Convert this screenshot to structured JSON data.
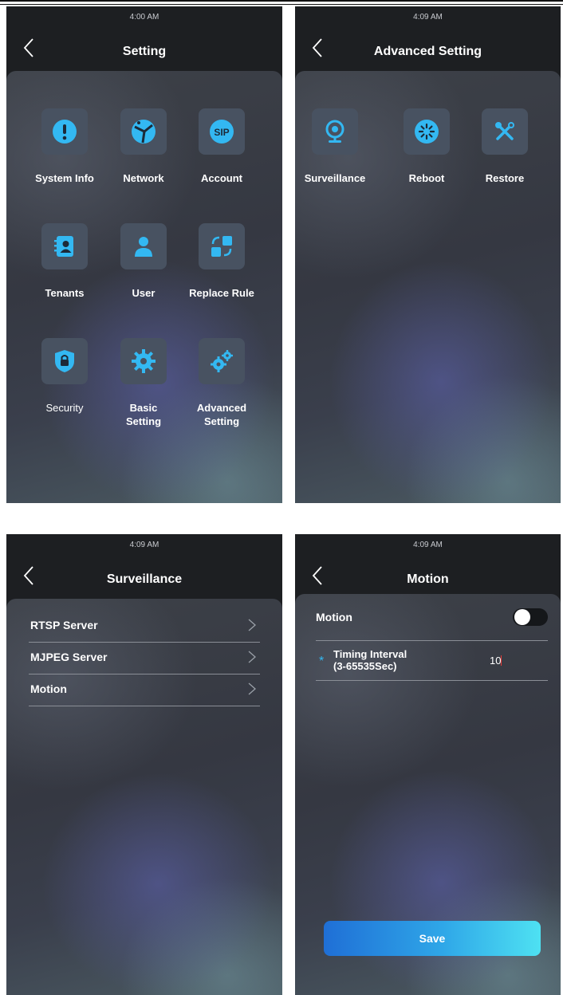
{
  "screens": {
    "setting": {
      "time": "4:00 AM",
      "title": "Setting",
      "items": [
        {
          "label": "System Info",
          "icon": "info-icon"
        },
        {
          "label": "Network",
          "icon": "network-icon"
        },
        {
          "label": "Account",
          "icon": "sip-icon"
        },
        {
          "label": "Tenants",
          "icon": "contacts-icon"
        },
        {
          "label": "User",
          "icon": "user-icon"
        },
        {
          "label": "Replace Rule",
          "icon": "replace-icon"
        },
        {
          "label": "Security",
          "icon": "shield-lock-icon"
        },
        {
          "label": "Basic\nSetting",
          "icon": "gear-icon"
        },
        {
          "label": "Advanced\nSetting",
          "icon": "gears-icon"
        }
      ]
    },
    "advanced": {
      "time": "4:09 AM",
      "title": "Advanced Setting",
      "items": [
        {
          "label": "Surveillance",
          "icon": "camera-icon"
        },
        {
          "label": "Reboot",
          "icon": "reboot-icon"
        },
        {
          "label": "Restore",
          "icon": "tools-icon"
        }
      ]
    },
    "surveillance": {
      "time": "4:09 AM",
      "title": "Surveillance",
      "rows": [
        {
          "label": "RTSP Server"
        },
        {
          "label": "MJPEG Server"
        },
        {
          "label": "Motion"
        }
      ]
    },
    "motion": {
      "time": "4:09 AM",
      "title": "Motion",
      "motion_label": "Motion",
      "motion_enabled": false,
      "required_mark": "*",
      "timing_label_1": "Timing Interval",
      "timing_label_2": "(3-65535Sec)",
      "timing_value": "10",
      "save_label": "Save"
    }
  },
  "colors": {
    "accent": "#33b8f2",
    "tile_bg": "#485261",
    "screen_bg": "#1d1f22"
  }
}
